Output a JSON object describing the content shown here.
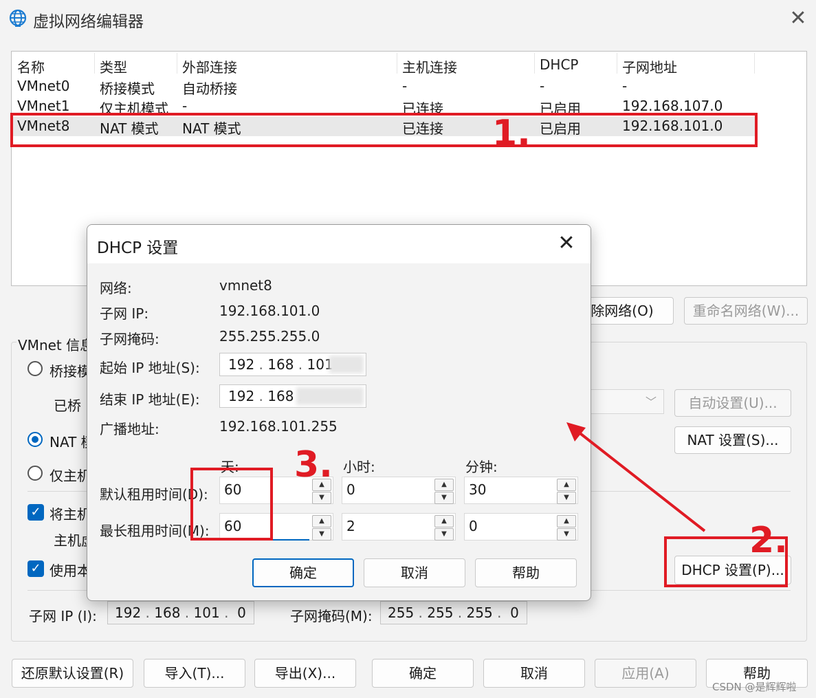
{
  "window": {
    "title": "虚拟网络编辑器"
  },
  "table": {
    "headers": [
      "名称",
      "类型",
      "外部连接",
      "主机连接",
      "DHCP",
      "子网地址"
    ],
    "rows": [
      [
        "VMnet0",
        "桥接模式",
        "自动桥接",
        "-",
        "-",
        "-"
      ],
      [
        "VMnet1",
        "仅主机模式",
        "-",
        "已连接",
        "已启用",
        "192.168.107.0"
      ],
      [
        "VMnet8",
        "NAT 模式",
        "NAT 模式",
        "已连接",
        "已启用",
        "192.168.101.0"
      ]
    ]
  },
  "buttons": {
    "remove_network": "除网络(O)",
    "rename_network": "重命名网络(W)...",
    "auto_settings": "自动设置(U)...",
    "nat_settings": "NAT 设置(S)...",
    "dhcp_settings": "DHCP 设置(P)...",
    "restore": "还原默认设置(R)",
    "import": "导入(T)...",
    "export": "导出(X)...",
    "ok": "确定",
    "cancel": "取消",
    "apply": "应用(A)",
    "help": "帮助"
  },
  "vmnet_info": {
    "label": "VMnet 信息",
    "bridge_radio": "桥接模",
    "bridged_to": "已桥",
    "nat_radio": "NAT 模",
    "host_only_radio": "仅主机",
    "connect_host_check": "将主机",
    "host_adapter_label": "主机虚",
    "use_dhcp_check": "使用本",
    "subnet_ip_label": "子网 IP (I):",
    "subnet_ip": [
      "192",
      "168",
      "101",
      "0"
    ],
    "subnet_mask_label": "子网掩码(M):",
    "subnet_mask": [
      "255",
      "255",
      "255",
      "0"
    ]
  },
  "dhcp_dialog": {
    "title": "DHCP 设置",
    "network_label": "网络:",
    "network": "vmnet8",
    "subnet_ip_label": "子网 IP:",
    "subnet_ip": "192.168.101.0",
    "subnet_mask_label": "子网掩码:",
    "subnet_mask": "255.255.255.0",
    "start_ip_label": "起始 IP 地址(S):",
    "start_ip": [
      "192",
      "168",
      "101"
    ],
    "end_ip_label": "结束 IP 地址(E):",
    "end_ip": [
      "192",
      "168"
    ],
    "broadcast_label": "广播地址:",
    "broadcast": "192.168.101.255",
    "col_days": "天:",
    "col_hours": "小时:",
    "col_minutes": "分钟:",
    "default_lease_label": "默认租用时间(D):",
    "default_lease": {
      "days": "60",
      "hours": "0",
      "minutes": "30"
    },
    "max_lease_label": "最长租用时间(M):",
    "max_lease": {
      "days": "60",
      "hours": "2",
      "minutes": "0"
    },
    "ok": "确定",
    "cancel": "取消",
    "help": "帮助"
  },
  "annotations": {
    "step1": "1.",
    "step2": "2.",
    "step3": "3.",
    "color": "#e01b24"
  },
  "watermark": "CSDN @是辉辉啦"
}
